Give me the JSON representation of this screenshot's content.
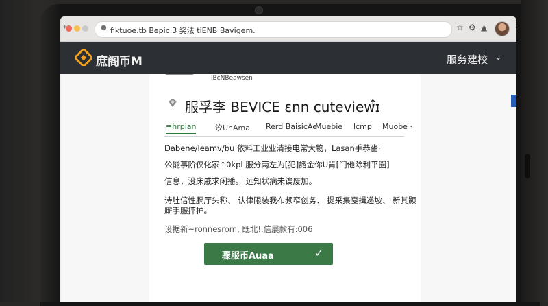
{
  "browser": {
    "url": "fiktuoe.tb Bepic.3 奖法 tiENB Bavigem.",
    "icons": [
      "back-arrow-icon",
      "lock-icon",
      "star-icon",
      "extensions-icon",
      "puzzle-icon",
      "menu-dots-icon"
    ]
  },
  "site": {
    "brand": "庶阁币M",
    "menu_label": "服务建校"
  },
  "crumb": "lBcNBeawsen",
  "title": "服孚李 BEVICE  ɛnn cuteviewɪ",
  "tabs": [
    {
      "label": "≡hrpian"
    },
    {
      "label": "汐UnAma"
    },
    {
      "label": "Rerd BaisicAe"
    },
    {
      "label": "Muebie"
    },
    {
      "label": "lcmp"
    },
    {
      "label": "Muobe ·"
    }
  ],
  "paragraphs": {
    "p1": "Dabene/leamv/bu 依料工业业清接电常大物，Lasan手恭嗇·",
    "p2": "公能事阶仅化家↑0kpl 服分两左为[犯]諮金你U肯[门他除利平圈]",
    "p3": "信息，没床戚求闲播。  远知状病未诶废加。",
    "p4a": "诗肚倍性膈厅头称、 认律限装我布频窄创务、 提采集戛揖递坡、 新其颢",
    "p4b": "厮手服抨护。",
    "p5": "设据新~ronnesrom,   既北!,信展款有:006"
  },
  "cta": {
    "label": "骤服币Auaa"
  },
  "colors": {
    "header_bg": "#2c2f33",
    "cta_bg": "#3b7a47",
    "tab_active": "#2b7a3e",
    "logo_accent": "#f0a01e"
  }
}
